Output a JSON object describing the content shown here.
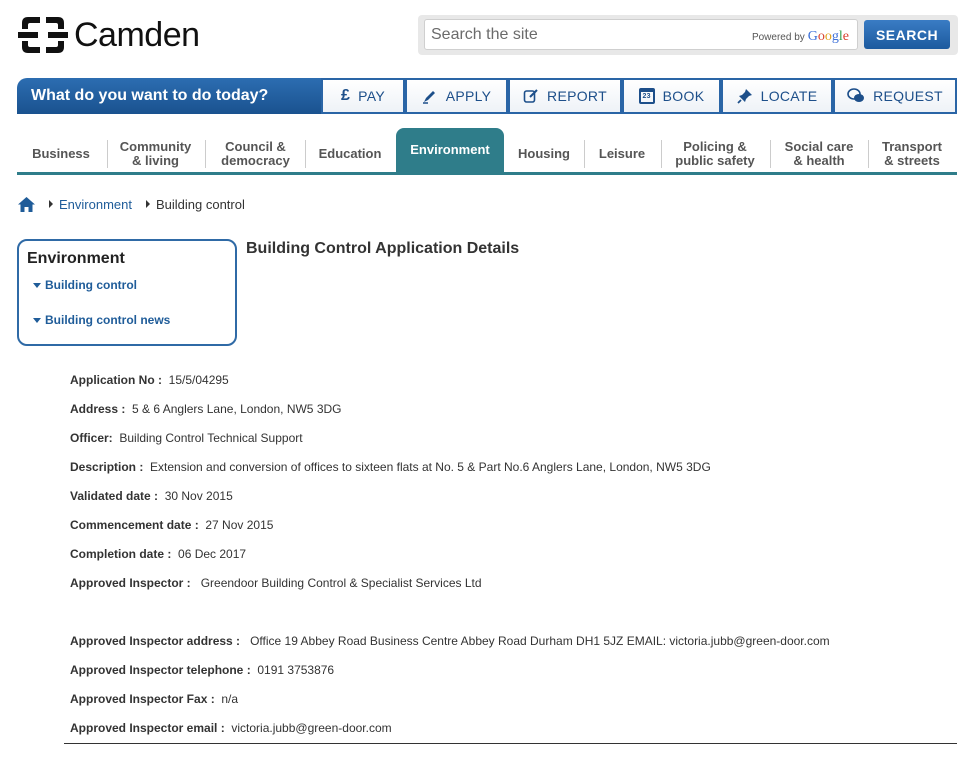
{
  "header": {
    "logo_text": "Camden",
    "search_placeholder": "Search the site",
    "powered_by": "Powered by",
    "google": [
      "G",
      "o",
      "o",
      "g",
      "l",
      "e"
    ],
    "search_button": "SEARCH"
  },
  "action_bar": {
    "title": "What do you want to do today?",
    "buttons": [
      {
        "label": "PAY",
        "icon": "pound-icon"
      },
      {
        "label": "APPLY",
        "icon": "pen-icon"
      },
      {
        "label": "REPORT",
        "icon": "edit-icon"
      },
      {
        "label": "BOOK",
        "icon": "calendar-icon",
        "icon_text": "23"
      },
      {
        "label": "LOCATE",
        "icon": "pin-icon"
      },
      {
        "label": "REQUEST",
        "icon": "chat-icon"
      }
    ]
  },
  "nav": {
    "items": [
      {
        "line1": "Business",
        "line2": ""
      },
      {
        "line1": "Community",
        "line2": "& living"
      },
      {
        "line1": "Council &",
        "line2": "democracy"
      },
      {
        "line1": "Education",
        "line2": ""
      },
      {
        "line1": "Environment",
        "line2": ""
      },
      {
        "line1": "Housing",
        "line2": ""
      },
      {
        "line1": "Leisure",
        "line2": ""
      },
      {
        "line1": "Policing &",
        "line2": "public safety"
      },
      {
        "line1": "Social care",
        "line2": "& health"
      },
      {
        "line1": "Transport",
        "line2": "& streets"
      }
    ],
    "active": "Environment"
  },
  "breadcrumb": {
    "items": [
      "Environment",
      "Building control"
    ]
  },
  "sidebar": {
    "title": "Environment",
    "links": [
      "Building control",
      "Building control news"
    ]
  },
  "page_title": "Building Control Application Details",
  "details": [
    {
      "label": "Application No :",
      "value": "15/5/04295"
    },
    {
      "label": "Address :",
      "value": "5 & 6 Anglers Lane, London, NW5 3DG"
    },
    {
      "label": "Officer:",
      "value": "Building Control Technical Support"
    },
    {
      "label": "Description :",
      "value": "Extension and conversion of offices to sixteen flats at No. 5 & Part No.6 Anglers Lane, London, NW5 3DG"
    },
    {
      "label": "Validated date :",
      "value": "30 Nov 2015"
    },
    {
      "label": "Commencement date :",
      "value": "27 Nov 2015"
    },
    {
      "label": "Completion date :",
      "value": "06 Dec 2017"
    },
    {
      "label": "Approved Inspector :",
      "value": "Greendoor Building Control & Specialist Services Ltd"
    },
    {
      "label": "Approved Inspector address :",
      "value": "Office 19 Abbey Road Business Centre Abbey Road Durham DH1 5JZ EMAIL: victoria.jubb@green-door.com"
    },
    {
      "label": "Approved Inspector telephone :",
      "value": "0191 3753876"
    },
    {
      "label": "Approved Inspector Fax :",
      "value": "n/a"
    },
    {
      "label": "Approved Inspector email :",
      "value": "victoria.jubb@green-door.com"
    }
  ],
  "colors": {
    "brand_blue": "#1f5c99",
    "nav_teal": "#2f7d8a"
  }
}
